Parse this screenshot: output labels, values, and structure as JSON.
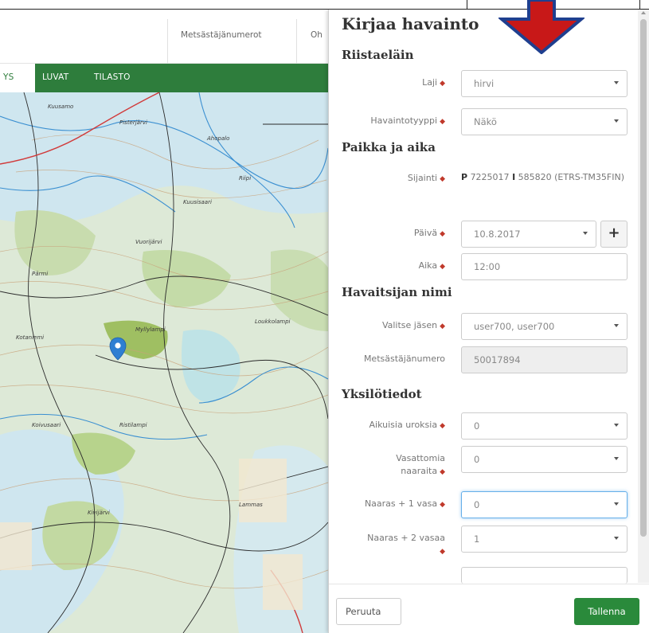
{
  "top_nav": {
    "links": [
      "Metsästäjänumerot",
      "Oh"
    ]
  },
  "main_menu": {
    "items": [
      "YS",
      "LUVAT",
      "TILASTO"
    ]
  },
  "map": {
    "marker": "map-pin-icon",
    "labels": [
      "Kuusamo",
      "Pisterjärvi",
      "Ahopalo",
      "Riipi",
      "Kuusisaari",
      "Vuorijärvi",
      "Pärmi",
      "Myllylampi",
      "Loukkolampi",
      "Kotaniemi",
      "Koivusaari",
      "Ristilampi",
      "Kivijärvi",
      "Lammas"
    ]
  },
  "panel": {
    "title": "Kirjaa havainto",
    "sections": {
      "species": "Riistaeläin",
      "place_time": "Paikka ja aika",
      "observer": "Havaitsijan nimi",
      "details": "Yksilötiedot"
    },
    "fields": {
      "species": {
        "label": "Laji",
        "value": "hirvi"
      },
      "obs_type": {
        "label": "Havaintotyyppi",
        "value": "Näkö"
      },
      "location": {
        "label": "Sijainti",
        "p_prefix": "P",
        "p_value": "7225017",
        "i_prefix": "I",
        "i_value": "585820 (ETRS-TM35FIN)"
      },
      "date": {
        "label": "Päivä",
        "value": "10.8.2017",
        "add_label": "+"
      },
      "time": {
        "label": "Aika",
        "value": "12:00"
      },
      "member": {
        "label": "Valitse jäsen",
        "value": "user700, user700"
      },
      "hunter_no": {
        "label": "Metsästäjänumero",
        "value": "50017894"
      },
      "adult_males": {
        "label": "Aikuisia uroksia",
        "value": "0"
      },
      "calfless_females": {
        "label": "Vasattomia naaraita",
        "value": "0"
      },
      "female_1_calf": {
        "label": "Naaras + 1 vasa",
        "value": "0"
      },
      "female_2_calves": {
        "label": "Naaras + 2 vasaa",
        "value": "1"
      }
    },
    "required_marker": "◆",
    "buttons": {
      "cancel": "Peruuta",
      "save": "Tallenna"
    }
  },
  "colors": {
    "nav_green": "#2e7d3c",
    "save_green": "#2a8a3b",
    "required_red": "#c0392b",
    "arrow_red": "#c81818",
    "arrow_outline": "#1f3f8f"
  }
}
